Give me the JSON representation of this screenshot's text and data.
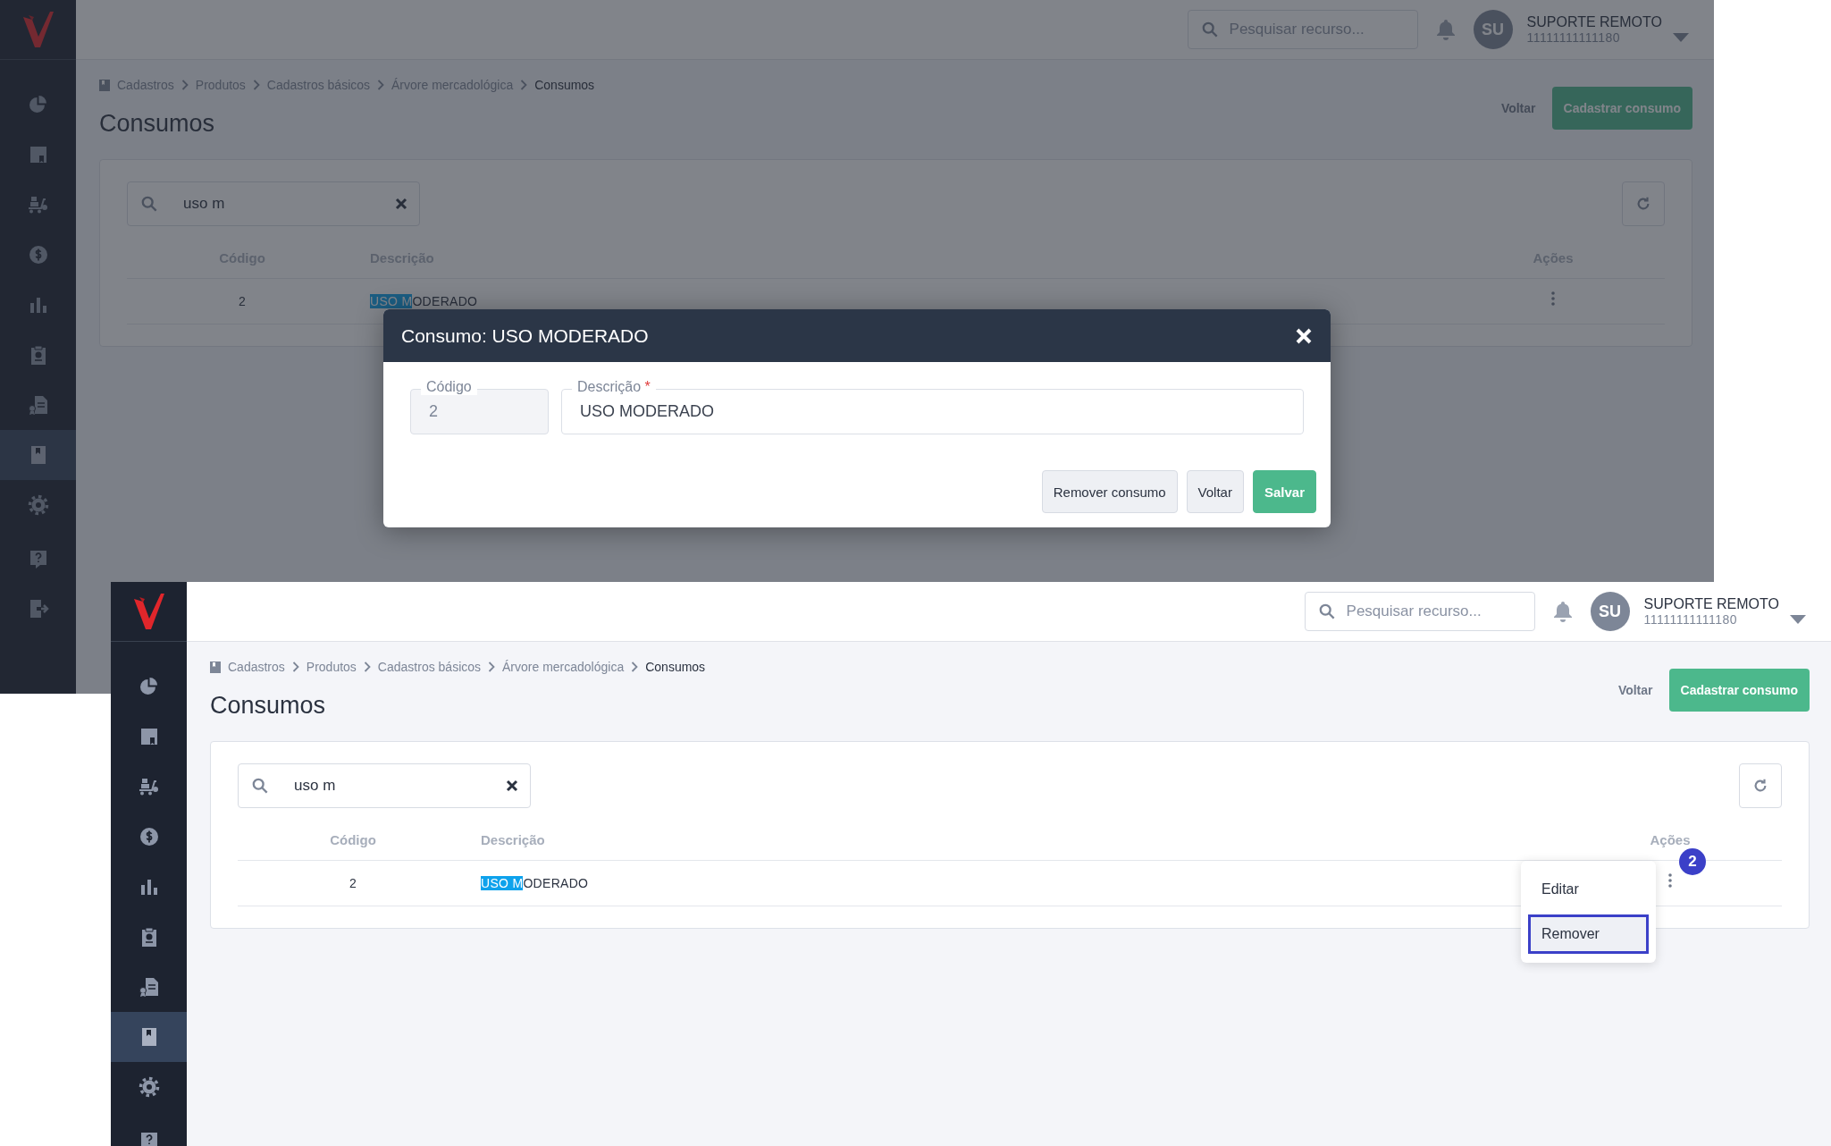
{
  "screens": [
    {
      "sidebar": {
        "items": [
          {
            "selected": false
          },
          {
            "selected": false
          },
          {
            "selected": false
          },
          {
            "selected": false
          },
          {
            "selected": false
          },
          {
            "selected": false
          },
          {
            "selected": false
          },
          {
            "selected": true
          },
          {
            "selected": false
          },
          {
            "selected": false
          },
          {
            "selected": false
          }
        ]
      },
      "header": {
        "search": {
          "placeholder": "Pesquisar recurso..."
        },
        "user": {
          "initials": "SU",
          "name": "SUPORTE REMOTO",
          "id": "11111111111180"
        }
      },
      "breadcrumb": [
        "Cadastros",
        "Produtos",
        "Cadastros básicos",
        "Árvore mercadológica",
        "Consumos"
      ],
      "title": "Consumos",
      "actions": [
        {
          "label": "Voltar",
          "kind": "link"
        },
        {
          "label": "Cadastrar consumo",
          "kind": "primary"
        }
      ],
      "filter": {
        "value": "uso m"
      },
      "table": {
        "columns": [
          "Código",
          "Descrição",
          "Ações"
        ],
        "rows": [
          {
            "code": "2",
            "description": [
              {
                "text": "USO M",
                "highlighted": true
              },
              {
                "text": "ODERADO",
                "highlighted": false
              }
            ]
          }
        ]
      },
      "modal": {
        "title": "Consumo: USO MODERADO",
        "fields": [
          {
            "label": "Código",
            "value": "2",
            "disabled": true
          },
          {
            "label": "Descrição",
            "required_mark": "*",
            "value": "USO MODERADO",
            "disabled": false
          }
        ],
        "buttons": [
          {
            "label": "Remover consumo",
            "kind": "secondary"
          },
          {
            "label": "Voltar",
            "kind": "secondary"
          },
          {
            "label": "Salvar",
            "kind": "primary"
          }
        ]
      }
    },
    {
      "sidebar": {
        "items": [
          {
            "selected": false
          },
          {
            "selected": false
          },
          {
            "selected": false
          },
          {
            "selected": false
          },
          {
            "selected": false
          },
          {
            "selected": false
          },
          {
            "selected": false
          },
          {
            "selected": true
          },
          {
            "selected": false
          },
          {
            "selected": false
          }
        ]
      },
      "header": {
        "search": {
          "placeholder": "Pesquisar recurso..."
        },
        "user": {
          "initials": "SU",
          "name": "SUPORTE REMOTO",
          "id": "11111111111180"
        }
      },
      "breadcrumb": [
        "Cadastros",
        "Produtos",
        "Cadastros básicos",
        "Árvore mercadológica",
        "Consumos"
      ],
      "title": "Consumos",
      "actions": [
        {
          "label": "Voltar",
          "kind": "link"
        },
        {
          "label": "Cadastrar consumo",
          "kind": "primary"
        }
      ],
      "filter": {
        "value": "uso m"
      },
      "table": {
        "columns": [
          "Código",
          "Descrição",
          "Ações"
        ],
        "rows": [
          {
            "code": "2",
            "description": [
              {
                "text": "USO M",
                "highlighted": true
              },
              {
                "text": "ODERADO",
                "highlighted": false
              }
            ],
            "badge": "2",
            "menu": {
              "items": [
                {
                  "label": "Editar",
                  "selected": false
                },
                {
                  "label": "Remover",
                  "selected": true
                }
              ]
            }
          }
        ]
      }
    }
  ]
}
